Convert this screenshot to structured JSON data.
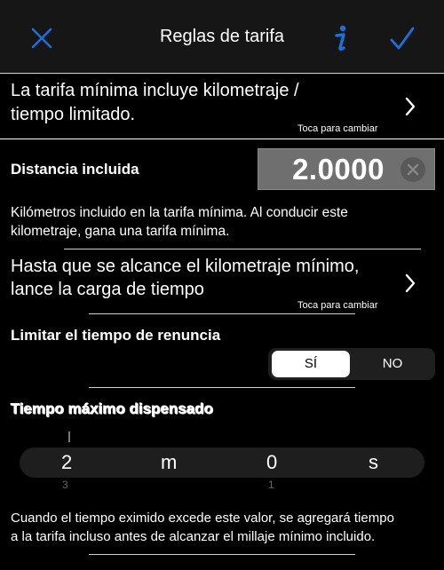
{
  "header": {
    "title": "Reglas de tarifa",
    "close_icon": "close-icon",
    "info_icon": "info-icon",
    "done_icon": "checkmark-icon",
    "accent_color": "#1e6fd9"
  },
  "row1": {
    "text_line1": "La tarifa mínima incluye kilometraje /",
    "text_line2": "tiempo limitado.",
    "hint": "Toca para cambiar"
  },
  "distance": {
    "label": "Distancia incluida",
    "value": "2.0000",
    "desc_line1": "Kilómetros incluido en la tarifa mínima. Al conducir este",
    "desc_line2": "kilometraje, gana una tarifa mínima."
  },
  "row2": {
    "text_line1": "Hasta que se alcance el kilometraje mínimo,",
    "text_line2": "lance la carga de tiempo",
    "hint": "Toca para cambiar"
  },
  "waiver": {
    "label": "Limitar el tiempo de renuncia",
    "options": [
      "SÍ",
      "NO"
    ],
    "selected": "SÍ"
  },
  "max_time": {
    "label": "Tiempo máximo dispensado",
    "picker": {
      "hours": "2",
      "hours_unit": "m",
      "minutes": "0",
      "minutes_unit": "s",
      "above_hours": "1",
      "below_hours": "3",
      "below_minutes": "1"
    },
    "desc_line1": "Cuando el tiempo eximido excede este valor, se agregará tiempo",
    "desc_line2": "a la tarifa incluso antes de alcanzar el millaje mínimo incluido."
  }
}
